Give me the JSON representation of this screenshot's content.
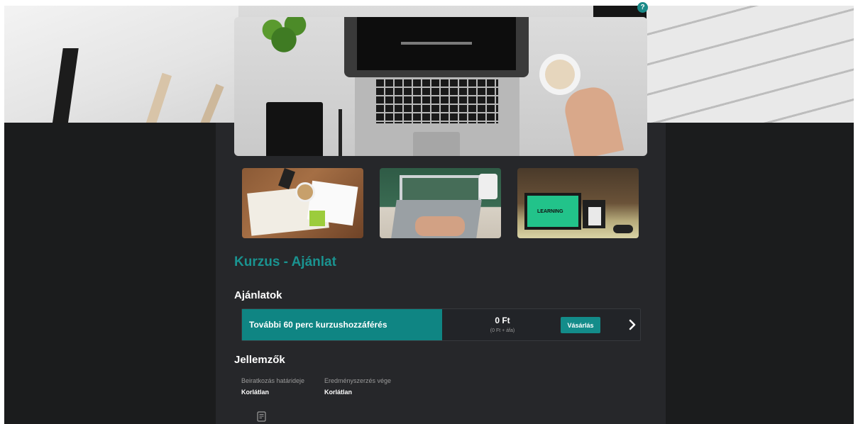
{
  "header": {
    "help_label": "?"
  },
  "hero": {
    "main_image": "laptop-workspace-photo",
    "thumbnails": [
      {
        "image": "desk-notebook-coffee-photo"
      },
      {
        "image": "laptop-chalkboard-lecture-photo"
      },
      {
        "image": "e-learning-monitor-photo",
        "caption": "LEARNING"
      }
    ]
  },
  "page": {
    "title": "Kurzus - Ajánlat"
  },
  "offers": {
    "title": "Ajánlatok",
    "items": [
      {
        "name": "További 60 perc kurzushozzáférés",
        "price": "0 Ft",
        "price_detail": "(0 Ft + áfa)",
        "buy_label": "Vásárlás",
        "expand_icon": "chevron-right-icon"
      }
    ]
  },
  "features": {
    "title": "Jellemzők",
    "items": [
      {
        "label": "Beiratkozás határideje",
        "value": "Korlátlan"
      },
      {
        "label": "Eredményszerzés vége",
        "value": "Korlátlan"
      }
    ],
    "extra_icon": "document-icon"
  },
  "colors": {
    "accent": "#1a9390",
    "offer_highlight": "#0f8583",
    "background_dark": "#1b1c1d",
    "content_panel": "#26272a"
  }
}
